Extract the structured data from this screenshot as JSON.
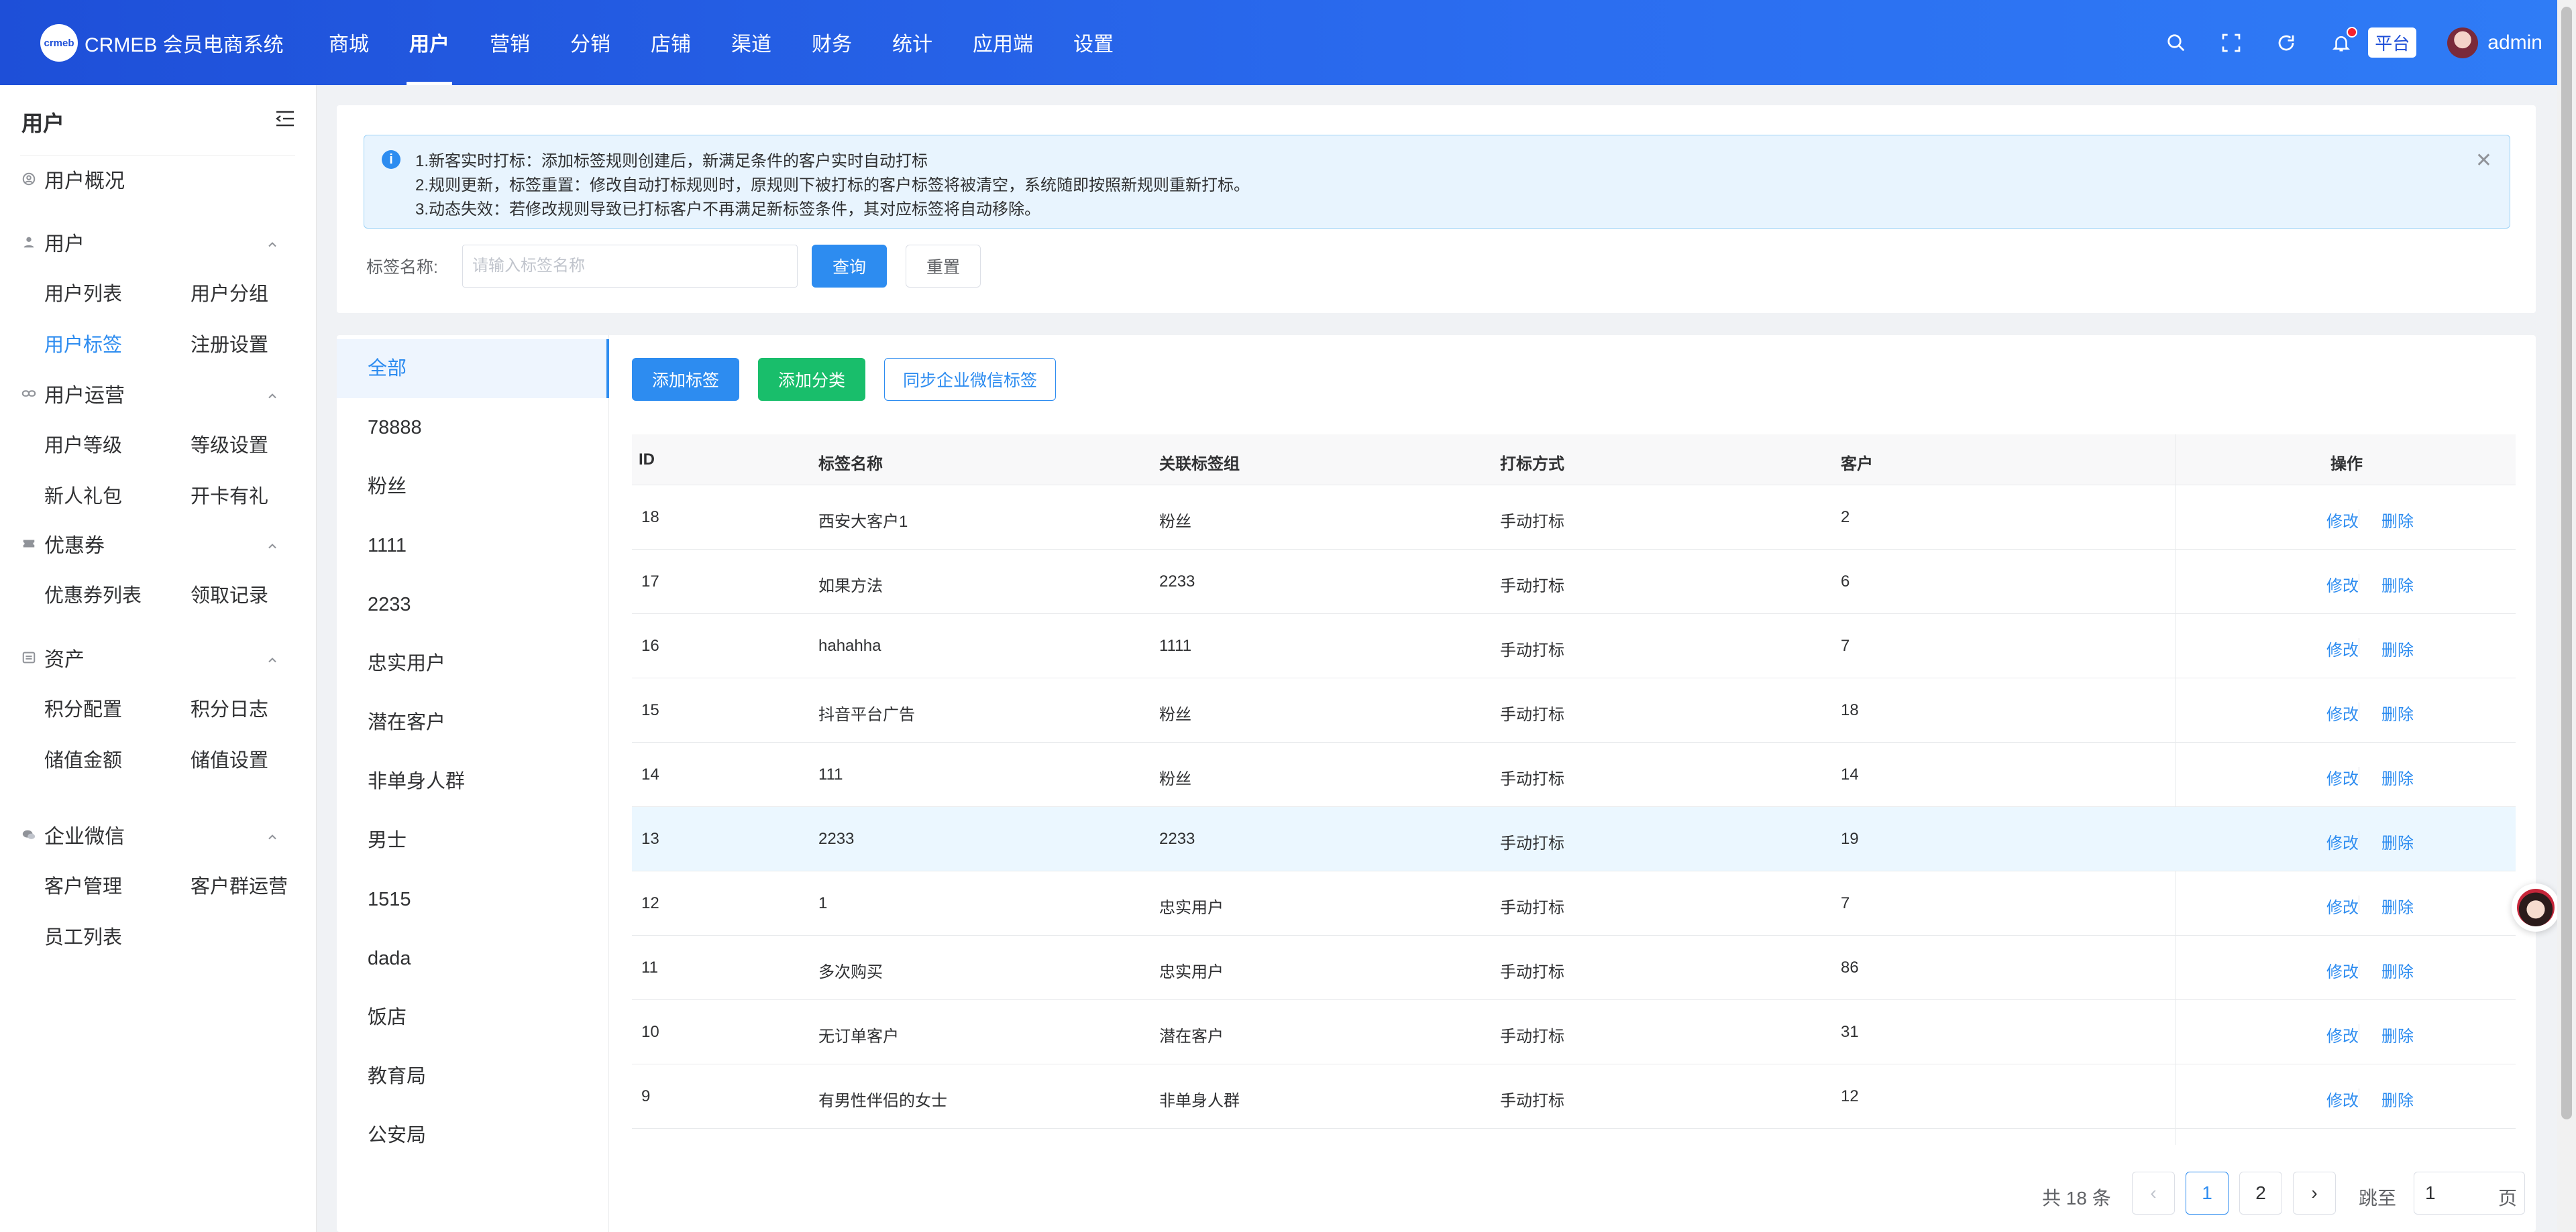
{
  "brand": {
    "logo_mark": "crmeb",
    "name": "CRMEB 会员电商系统"
  },
  "topnav": [
    {
      "label": "商城",
      "active": false
    },
    {
      "label": "用户",
      "active": true
    },
    {
      "label": "营销",
      "active": false
    },
    {
      "label": "分销",
      "active": false
    },
    {
      "label": "店铺",
      "active": false
    },
    {
      "label": "渠道",
      "active": false
    },
    {
      "label": "财务",
      "active": false
    },
    {
      "label": "统计",
      "active": false
    },
    {
      "label": "应用端",
      "active": false
    },
    {
      "label": "设置",
      "active": false
    }
  ],
  "header": {
    "platform_badge": "平台",
    "username": "admin",
    "icons": [
      "search-icon",
      "fullscreen-icon",
      "refresh-icon",
      "bell-icon"
    ]
  },
  "sidebar": {
    "title": "用户",
    "groups": [
      {
        "label": "用户概况",
        "icon": "user-circle-icon",
        "items": []
      },
      {
        "label": "用户",
        "icon": "person-icon",
        "items": [
          "用户列表",
          "用户分组",
          "用户标签",
          "注册设置"
        ]
      },
      {
        "label": "用户运营",
        "icon": "link-icon",
        "items": [
          "用户等级",
          "等级设置",
          "新人礼包",
          "开卡有礼"
        ]
      },
      {
        "label": "优惠券",
        "icon": "coupon-icon",
        "items": [
          "优惠券列表",
          "领取记录"
        ]
      },
      {
        "label": "资产",
        "icon": "asset-icon",
        "items": [
          "积分配置",
          "积分日志",
          "储值金额",
          "储值设置"
        ]
      },
      {
        "label": "企业微信",
        "icon": "wechat-work-icon",
        "items": [
          "客户管理",
          "客户群运营",
          "员工列表"
        ]
      }
    ],
    "active_item": "用户标签"
  },
  "alert": {
    "lines": [
      "1.新客实时打标：添加标签规则创建后，新满足条件的客户实时自动打标",
      "2.规则更新，标签重置：修改自动打标规则时，原规则下被打标的客户标签将被清空，系统随即按照新规则重新打标。",
      "3.动态失效：若修改规则导致已打标客户不再满足新标签条件，其对应标签将自动移除。"
    ]
  },
  "filter": {
    "label": "标签名称:",
    "value": "",
    "placeholder": "请输入标签名称",
    "query_label": "查询",
    "reset_label": "重置"
  },
  "categories": {
    "items": [
      "全部",
      "78888",
      "粉丝",
      "1111",
      "2233",
      "忠实用户",
      "潜在客户",
      "非单身人群",
      "男士",
      "1515",
      "dada",
      "饭店",
      "教育局",
      "公安局"
    ],
    "active": "全部"
  },
  "toolbar": {
    "add_tag": "添加标签",
    "add_category": "添加分类",
    "sync_wechat": "同步企业微信标签"
  },
  "table": {
    "columns": [
      "ID",
      "标签名称",
      "关联标签组",
      "打标方式",
      "客户",
      "操作"
    ],
    "rows": [
      {
        "id": "18",
        "name": "西安大客户1",
        "group": "粉丝",
        "method": "手动打标",
        "customers": "2"
      },
      {
        "id": "17",
        "name": "如果方法",
        "group": "2233",
        "method": "手动打标",
        "customers": "6"
      },
      {
        "id": "16",
        "name": "hahahha",
        "group": "1111",
        "method": "手动打标",
        "customers": "7"
      },
      {
        "id": "15",
        "name": "抖音平台广告",
        "group": "粉丝",
        "method": "手动打标",
        "customers": "18"
      },
      {
        "id": "14",
        "name": "111",
        "group": "粉丝",
        "method": "手动打标",
        "customers": "14"
      },
      {
        "id": "13",
        "name": "2233",
        "group": "2233",
        "method": "手动打标",
        "customers": "19"
      },
      {
        "id": "12",
        "name": "1",
        "group": "忠实用户",
        "method": "手动打标",
        "customers": "7"
      },
      {
        "id": "11",
        "name": "多次购买",
        "group": "忠实用户",
        "method": "手动打标",
        "customers": "86"
      },
      {
        "id": "10",
        "name": "无订单客户",
        "group": "潜在客户",
        "method": "手动打标",
        "customers": "31"
      },
      {
        "id": "9",
        "name": "有男性伴侣的女士",
        "group": "非单身人群",
        "method": "手动打标",
        "customers": "12"
      }
    ],
    "edit_label": "修改",
    "delete_label": "删除"
  },
  "pagination": {
    "total_text": "共 18 条",
    "pages": [
      "1",
      "2"
    ],
    "current": "1",
    "jump_label": "跳至",
    "jump_value": "1",
    "jump_unit": "页"
  },
  "colors": {
    "primary": "#2d8cf0",
    "success": "#19be6b",
    "header_start": "#1e4fd8",
    "header_end": "#2f7cf6"
  }
}
